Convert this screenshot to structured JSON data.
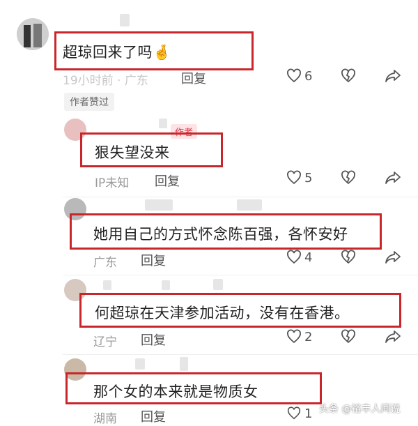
{
  "comments": [
    {
      "text": "超琼回来了吗",
      "meta": "19小时前 · 广东",
      "reply": "回复",
      "likes": "6"
    },
    {
      "text": "狠失望没来",
      "meta": "IP未知",
      "reply": "回复",
      "likes": "5",
      "tag": "作者"
    },
    {
      "text": "她用自己的方式怀念陈百强，各怀安好",
      "meta": "广东",
      "reply": "回复",
      "likes": "4"
    },
    {
      "text": "何超琼在天津参加活动，没有在香港。",
      "meta": "辽宁",
      "reply": "回复",
      "likes": "2"
    },
    {
      "text": "那个女的本来就是物质女",
      "meta": "湖南",
      "reply": "回复",
      "likes": "1"
    }
  ],
  "emoji": "🤞",
  "author_liked": "作者赞过",
  "watermark": "头条 @裕丰人间说"
}
